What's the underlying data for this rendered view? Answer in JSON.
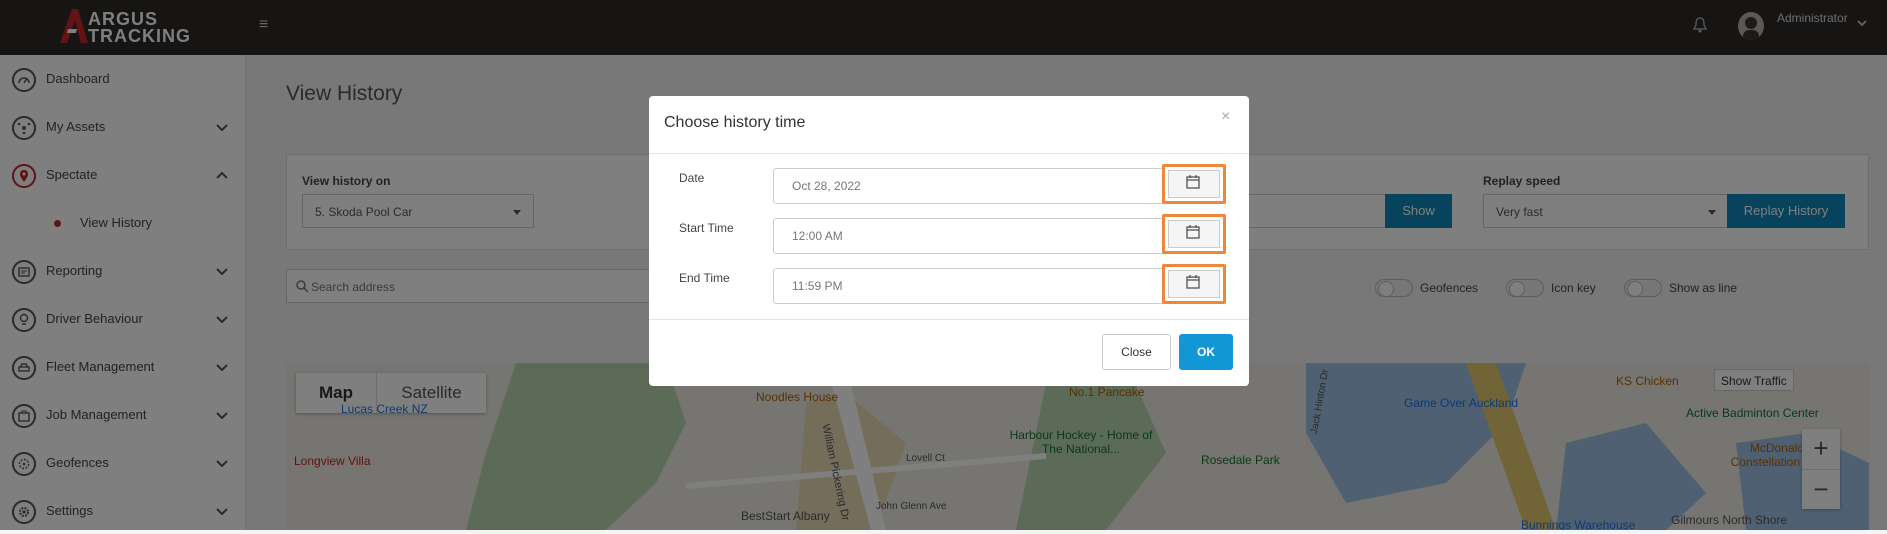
{
  "brand": {
    "line1": "ARGUS",
    "line2": "TRACKING",
    "accent": "#c2272d"
  },
  "header": {
    "user_name": "Administrator",
    "icons": [
      "hamburger-icon",
      "bell-icon",
      "chevron-down-icon"
    ]
  },
  "sidebar": {
    "items": [
      {
        "label": "Dashboard",
        "icon": "dashboard-icon"
      },
      {
        "label": "My Assets",
        "icon": "assets-icon"
      },
      {
        "label": "Spectate",
        "icon": "location-pin-icon"
      },
      {
        "label": "Reporting",
        "icon": "reporting-icon"
      },
      {
        "label": "Driver Behaviour",
        "icon": "bulb-icon"
      },
      {
        "label": "Fleet Management",
        "icon": "car-icon"
      },
      {
        "label": "Job Management",
        "icon": "briefcase-icon"
      },
      {
        "label": "Geofences",
        "icon": "geofence-icon"
      },
      {
        "label": "Settings",
        "icon": "gear-icon"
      }
    ],
    "sub_item": "View History"
  },
  "main": {
    "title": "View History",
    "view_history_on_label": "View history on",
    "vehicle_selected": "5. Skoda Pool Car",
    "show_button": "Show",
    "replay_speed_label": "Replay speed",
    "replay_speed_selected": "Very fast",
    "replay_button": "Replay History",
    "search_placeholder": "Search address",
    "toggles": [
      "Geofences",
      "Icon key",
      "Show as line"
    ]
  },
  "map": {
    "tabs": [
      "Map",
      "Satellite"
    ],
    "show_traffic": "Show Traffic",
    "labels": [
      "Lucas Creek NZ",
      "Longview Villa",
      "Noodles House",
      "No.1 Pancake",
      "Harbour Hockey - Home of The National...",
      "Rosedale Park",
      "Game Over Auckland",
      "KS Chicken",
      "Active Badminton Center",
      "McDonald's Constellation Drive",
      "BestStart Albany",
      "Bunnings Warehouse",
      "Gilmours North Shore",
      "William Pickering Dr",
      "John Glenn Ave",
      "Lovell Ct",
      "Jack Hinton Dr"
    ],
    "zoom_in": "+",
    "zoom_out": "−"
  },
  "modal": {
    "title": "Choose history time",
    "close_symbol": "×",
    "fields": [
      {
        "label": "Date",
        "value": "Oct 28, 2022"
      },
      {
        "label": "Start Time",
        "value": "12:00 AM"
      },
      {
        "label": "End Time",
        "value": "11:59 PM"
      }
    ],
    "close_button": "Close",
    "ok_button": "OK",
    "highlight_color": "#f0863a"
  }
}
